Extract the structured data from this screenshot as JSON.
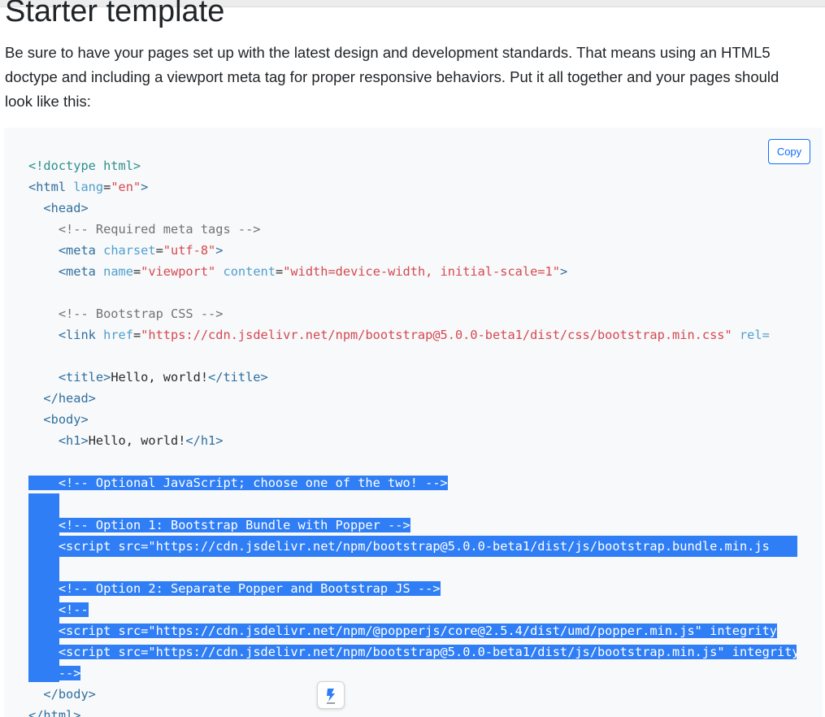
{
  "page": {
    "heading": "Starter template",
    "lead": "Be sure to have your pages set up with the latest design and development standards. That means using an HTML5 doctype and including a viewport meta tag for proper responsive behaviors. Put it all together and your pages should look like this:"
  },
  "code_block": {
    "copy_label": "Copy",
    "lines": [
      [
        [
          "d",
          "<!doctype html>"
        ]
      ],
      [
        [
          "t",
          "<html "
        ],
        [
          "a",
          "lang"
        ],
        [
          "p",
          "="
        ],
        [
          "s",
          "\"en\""
        ],
        [
          "t",
          ">"
        ]
      ],
      [
        [
          "p",
          "  "
        ],
        [
          "t",
          "<head>"
        ]
      ],
      [
        [
          "p",
          "    "
        ],
        [
          "c",
          "<!-- Required meta tags -->"
        ]
      ],
      [
        [
          "p",
          "    "
        ],
        [
          "t",
          "<meta "
        ],
        [
          "a",
          "charset"
        ],
        [
          "p",
          "="
        ],
        [
          "s",
          "\"utf-8\""
        ],
        [
          "t",
          ">"
        ]
      ],
      [
        [
          "p",
          "    "
        ],
        [
          "t",
          "<meta "
        ],
        [
          "a",
          "name"
        ],
        [
          "p",
          "="
        ],
        [
          "s",
          "\"viewport\""
        ],
        [
          "p",
          " "
        ],
        [
          "a",
          "content"
        ],
        [
          "p",
          "="
        ],
        [
          "s",
          "\"width=device-width, initial-scale=1\""
        ],
        [
          "t",
          ">"
        ]
      ],
      [],
      [
        [
          "p",
          "    "
        ],
        [
          "c",
          "<!-- Bootstrap CSS -->"
        ]
      ],
      [
        [
          "p",
          "    "
        ],
        [
          "t",
          "<link "
        ],
        [
          "a",
          "href"
        ],
        [
          "p",
          "="
        ],
        [
          "s",
          "\"https://cdn.jsdelivr.net/npm/bootstrap@5.0.0-beta1/dist/css/bootstrap.min.css\""
        ],
        [
          "p",
          " "
        ],
        [
          "a",
          "rel="
        ]
      ],
      [],
      [
        [
          "p",
          "    "
        ],
        [
          "t",
          "<title>"
        ],
        [
          "p",
          "Hello, world!"
        ],
        [
          "t",
          "</title>"
        ]
      ],
      [
        [
          "p",
          "  "
        ],
        [
          "t",
          "</head>"
        ]
      ],
      [
        [
          "p",
          "  "
        ],
        [
          "t",
          "<body>"
        ]
      ],
      [
        [
          "p",
          "    "
        ],
        [
          "t",
          "<h1>"
        ],
        [
          "p",
          "Hello, world!"
        ],
        [
          "t",
          "</h1>"
        ]
      ],
      [],
      [
        [
          "p",
          "    "
        ],
        [
          "c",
          "<!-- Optional JavaScript; choose one of the two! -->"
        ]
      ],
      [],
      [
        [
          "p",
          "    "
        ],
        [
          "c",
          "<!-- Option 1: Bootstrap Bundle with Popper -->"
        ]
      ],
      [
        [
          "p",
          "    "
        ],
        [
          "t",
          "<script "
        ],
        [
          "a",
          "src"
        ],
        [
          "p",
          "="
        ],
        [
          "s",
          "\"https://cdn.jsdelivr.net/npm/bootstrap@5.0.0-beta1/dist/js/bootstrap.bundle.min.js"
        ]
      ],
      [],
      [
        [
          "p",
          "    "
        ],
        [
          "c",
          "<!-- Option 2: Separate Popper and Bootstrap JS -->"
        ]
      ],
      [
        [
          "p",
          "    "
        ],
        [
          "c",
          "<!--"
        ]
      ],
      [
        [
          "p",
          "    "
        ],
        [
          "t",
          "<script "
        ],
        [
          "a",
          "src"
        ],
        [
          "p",
          "="
        ],
        [
          "s",
          "\"https://cdn.jsdelivr.net/npm/@popperjs/core@2.5.4/dist/umd/popper.min.js\""
        ],
        [
          "p",
          " "
        ],
        [
          "a",
          "integrity"
        ]
      ],
      [
        [
          "p",
          "    "
        ],
        [
          "t",
          "<script "
        ],
        [
          "a",
          "src"
        ],
        [
          "p",
          "="
        ],
        [
          "s",
          "\"https://cdn.jsdelivr.net/npm/bootstrap@5.0.0-beta1/dist/js/bootstrap.min.js\""
        ],
        [
          "p",
          " "
        ],
        [
          "a",
          "integrity"
        ]
      ],
      [
        [
          "p",
          "    "
        ],
        [
          "c",
          "-->"
        ]
      ],
      [
        [
          "p",
          "  "
        ],
        [
          "t",
          "</body>"
        ]
      ],
      [
        [
          "t",
          "</html>"
        ]
      ]
    ],
    "selected_lines": [
      15,
      16,
      17,
      18,
      19,
      20,
      21,
      22,
      23,
      24
    ]
  },
  "icons": {
    "floating_widget": "app-launcher-icon"
  }
}
